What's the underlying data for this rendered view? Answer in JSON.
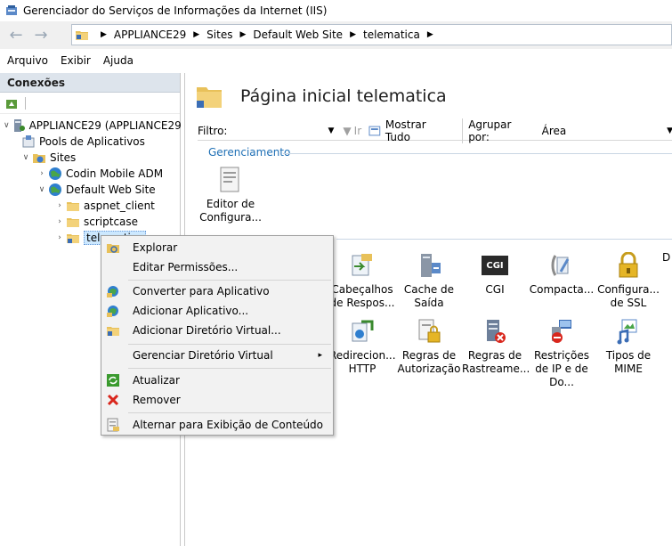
{
  "window": {
    "title": "Gerenciador do Serviços de Informações da Internet (IIS)"
  },
  "address": {
    "crumbs": [
      "APPLIANCE29",
      "Sites",
      "Default Web Site",
      "telematica"
    ]
  },
  "menu": [
    "Arquivo",
    "Exibir",
    "Ajuda"
  ],
  "connections": {
    "header": "Conexões",
    "tree": [
      {
        "label": "APPLIANCE29 (APPLIANCE29",
        "icon": "server-icon",
        "expander": "expanded"
      },
      {
        "label": "Pools de Aplicativos",
        "icon": "app-pool-icon",
        "expander": "none"
      },
      {
        "label": "Sites",
        "icon": "sites-folder-icon",
        "expander": "expanded"
      },
      {
        "label": "Codin Mobile ADM",
        "icon": "globe-icon",
        "expander": "collapsed"
      },
      {
        "label": "Default Web Site",
        "icon": "globe-icon",
        "expander": "expanded"
      },
      {
        "label": "aspnet_client",
        "icon": "folder-icon",
        "expander": "collapsed"
      },
      {
        "label": "scriptcase",
        "icon": "folder-icon",
        "expander": "collapsed"
      },
      {
        "label": "telematica",
        "icon": "virtual-folder-icon",
        "expander": "collapsed"
      }
    ]
  },
  "main": {
    "title": "Página inicial telematica",
    "filter": {
      "label": "Filtro:",
      "go": "Ir",
      "show_all": "Mostrar Tudo",
      "group_by_label": "Agrupar por:",
      "group_by_value": "Área"
    },
    "section": "Gerenciamento",
    "features": [
      {
        "label": "Editor de Configura...",
        "icon": "config-editor-icon"
      },
      {
        "label": "Cabeçalhos de Respos...",
        "icon": "response-headers-icon"
      },
      {
        "label": "Cache de Saída",
        "icon": "output-cache-icon"
      },
      {
        "label": "CGI",
        "icon": "cgi-icon",
        "text": "CGI"
      },
      {
        "label": "Compacta...",
        "icon": "compression-icon"
      },
      {
        "label": "Configura... de SSL",
        "icon": "ssl-lock-icon"
      },
      {
        "label": "Redirecion... HTTP",
        "icon": "http-redirect-icon"
      },
      {
        "label": "Regras de Autorização",
        "icon": "authorization-icon"
      },
      {
        "label": "Regras de Rastreame...",
        "icon": "tracing-rules-icon"
      },
      {
        "label": "Restrições de IP e de Do...",
        "icon": "ip-restrictions-icon"
      },
      {
        "label": "Tipos de MIME",
        "icon": "mime-types-icon"
      }
    ]
  },
  "context_menu": {
    "items": [
      {
        "label": "Explorar",
        "icon": "explore-icon"
      },
      {
        "label": "Editar Permissões...",
        "icon": ""
      },
      {
        "label": "Converter para Aplicativo",
        "icon": "convert-app-icon"
      },
      {
        "label": "Adicionar Aplicativo...",
        "icon": "add-app-icon"
      },
      {
        "label": "Adicionar Diretório Virtual...",
        "icon": "add-vdir-icon"
      },
      {
        "label": "Gerenciar Diretório Virtual",
        "icon": "",
        "arrow": "▸"
      },
      {
        "label": "Atualizar",
        "icon": "refresh-icon"
      },
      {
        "label": "Remover",
        "icon": "remove-icon"
      },
      {
        "label": "Alternar para Exibição de Conteúdo",
        "icon": "content-view-icon"
      }
    ]
  },
  "colors": {
    "accent_blue": "#1e6fb5",
    "selection": "#cce8ff",
    "panel_header": "#dde4ec",
    "remove_red": "#d9261c"
  }
}
